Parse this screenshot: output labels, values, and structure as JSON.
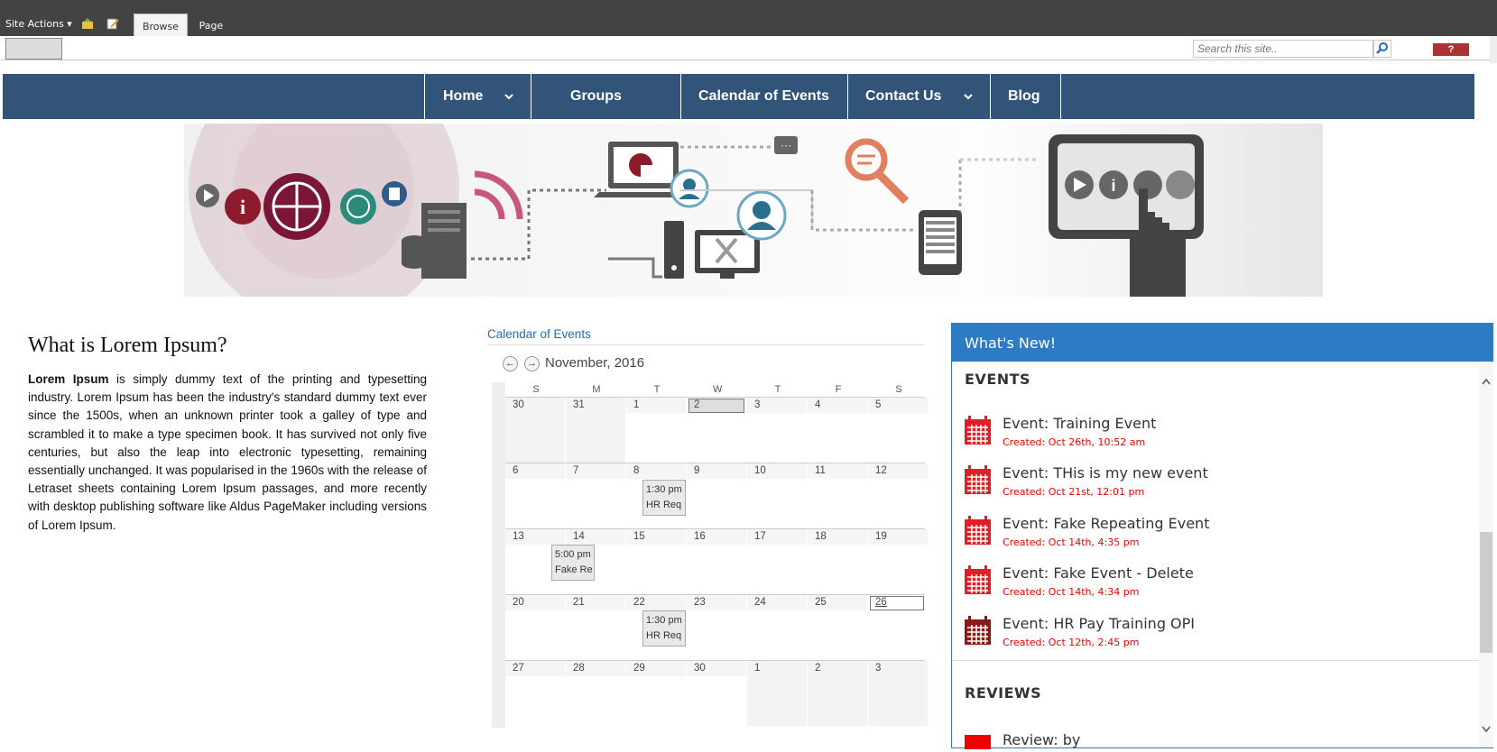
{
  "topbar": {
    "site_actions": "Site Actions ▾",
    "tabs": [
      "Browse",
      "Page"
    ]
  },
  "ribbon": {
    "search_placeholder": "Search this site..",
    "help": "?"
  },
  "nav": {
    "items": [
      "Home",
      "Groups",
      "Calendar of Events",
      "Contact Us",
      "Blog"
    ]
  },
  "article": {
    "title": "What is Lorem Ipsum?",
    "lead": "Lorem Ipsum",
    "body": " is simply dummy text of the printing and typesetting industry. Lorem Ipsum has been the industry's standard dummy text ever since the 1500s, when an unknown printer took a galley of type and scrambled it to make a type specimen book. It has survived not only five centuries, but also the leap into electronic typesetting, remaining essentially unchanged. It was popularised in the 1960s with the release of Letraset sheets containing Lorem Ipsum passages, and more recently with desktop publishing software like Aldus PageMaker including versions of Lorem Ipsum."
  },
  "calendar": {
    "title": "Calendar of Events",
    "month": "November, 2016",
    "prev": "←",
    "next": "→",
    "days_of_week": [
      "S",
      "M",
      "T",
      "W",
      "T",
      "F",
      "S"
    ],
    "weeks": [
      [
        "30",
        "31",
        "1",
        "2",
        "3",
        "4",
        "5"
      ],
      [
        "6",
        "7",
        "8",
        "9",
        "10",
        "11",
        "12"
      ],
      [
        "13",
        "14",
        "15",
        "16",
        "17",
        "18",
        "19"
      ],
      [
        "20",
        "21",
        "22",
        "23",
        "24",
        "25",
        "26"
      ],
      [
        "27",
        "28",
        "29",
        "30",
        "1",
        "2",
        "3"
      ]
    ],
    "events": [
      {
        "time": "1:30 pm",
        "title": "HR Req"
      },
      {
        "time": "5:00 pm",
        "title": "Fake Re"
      },
      {
        "time": "1:30 pm",
        "title": "HR Req"
      }
    ]
  },
  "whats_new": {
    "heading": "What's New!",
    "events_label": "EVENTS",
    "reviews_label": "REVIEWS",
    "events": [
      {
        "title": "Event: Training Event",
        "created": "Created: Oct 26th, 10:52 am"
      },
      {
        "title": "Event: THis is my new event",
        "created": "Created: Oct 21st, 12:01 pm"
      },
      {
        "title": "Event: Fake Repeating Event",
        "created": "Created: Oct 14th, 4:35 pm"
      },
      {
        "title": "Event: Fake Event - Delete",
        "created": "Created: Oct 14th, 4:34 pm"
      },
      {
        "title": "Event: HR Pay Training OPI",
        "created": "Created: Oct 12th, 2:45 pm"
      }
    ],
    "reviews": [
      {
        "title": "Review: by"
      }
    ]
  },
  "colors": {
    "nav_bg": "#325478",
    "whats_new_accent": "#2d7bc4",
    "created_red": "#e00000",
    "calendar_icon_red": "#e31e24",
    "calendar_icon_dark": "#8a1a1a"
  }
}
